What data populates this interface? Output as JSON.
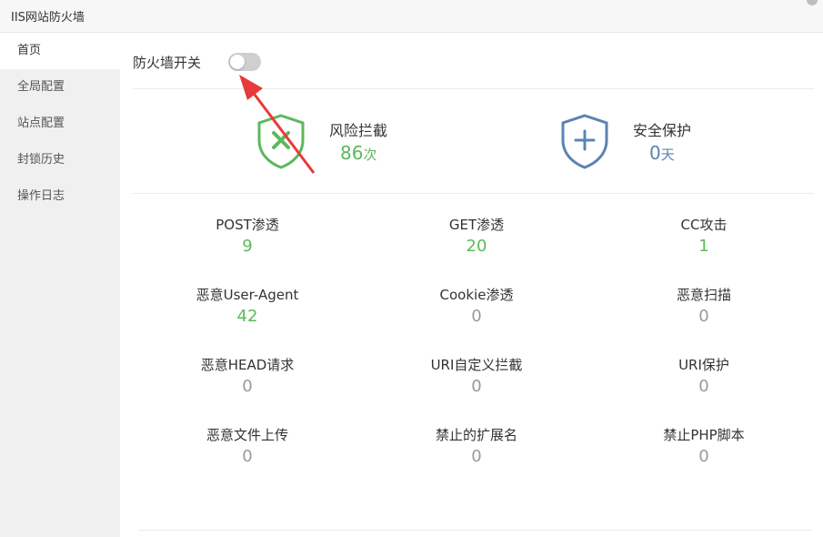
{
  "window": {
    "title": "IIS网站防火墙"
  },
  "sidebar": {
    "items": [
      {
        "label": "首页",
        "active": true
      },
      {
        "label": "全局配置",
        "active": false
      },
      {
        "label": "站点配置",
        "active": false
      },
      {
        "label": "封锁历史",
        "active": false
      },
      {
        "label": "操作日志",
        "active": false
      }
    ]
  },
  "switch": {
    "label": "防火墙开关",
    "on": false
  },
  "summary": {
    "risk": {
      "title": "风险拦截",
      "value": "86",
      "unit": "次",
      "color": "#5cb85c",
      "icon": "shield-x-icon"
    },
    "protect": {
      "title": "安全保护",
      "value": "0",
      "unit": "天",
      "color": "#5b84b1",
      "icon": "shield-plus-icon"
    }
  },
  "colors": {
    "positive": "#5cb85c",
    "zero": "#999999",
    "arrow": "#e83a3a"
  },
  "stats": [
    {
      "label": "POST渗透",
      "value": "9"
    },
    {
      "label": "GET渗透",
      "value": "20"
    },
    {
      "label": "CC攻击",
      "value": "1"
    },
    {
      "label": "恶意User-Agent",
      "value": "42"
    },
    {
      "label": "Cookie渗透",
      "value": "0"
    },
    {
      "label": "恶意扫描",
      "value": "0"
    },
    {
      "label": "恶意HEAD请求",
      "value": "0"
    },
    {
      "label": "URI自定义拦截",
      "value": "0"
    },
    {
      "label": "URI保护",
      "value": "0"
    },
    {
      "label": "恶意文件上传",
      "value": "0"
    },
    {
      "label": "禁止的扩展名",
      "value": "0"
    },
    {
      "label": "禁止PHP脚本",
      "value": "0"
    }
  ]
}
